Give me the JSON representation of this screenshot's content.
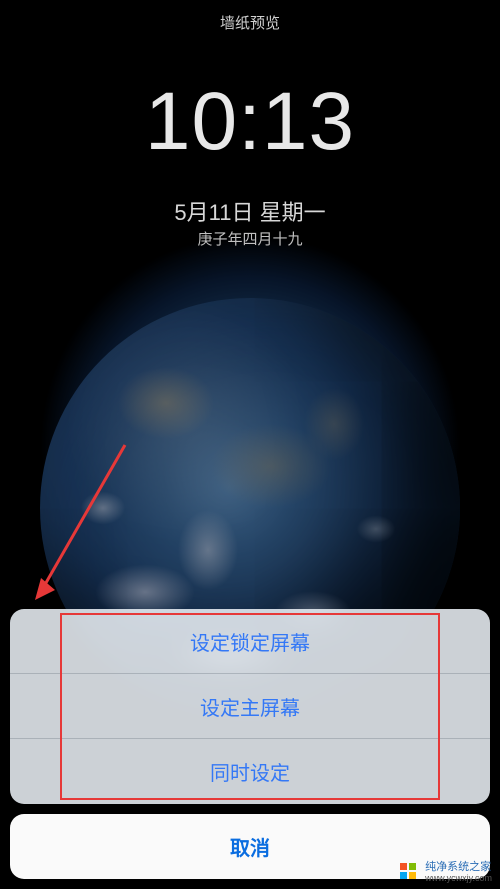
{
  "header": {
    "title": "墙纸预览"
  },
  "lockscreen": {
    "time": "10:13",
    "date": "5月11日 星期一",
    "lunar": "庚子年四月十九"
  },
  "sheet": {
    "set_lock": "设定锁定屏幕",
    "set_home": "设定主屏幕",
    "set_both": "同时设定",
    "cancel": "取消"
  },
  "watermark": {
    "name": "纯净系统之家",
    "url": "www.ycwxjy.com"
  },
  "colors": {
    "action_text": "#3478f6",
    "cancel_text": "#0a6de0",
    "highlight_box": "#e63838"
  }
}
